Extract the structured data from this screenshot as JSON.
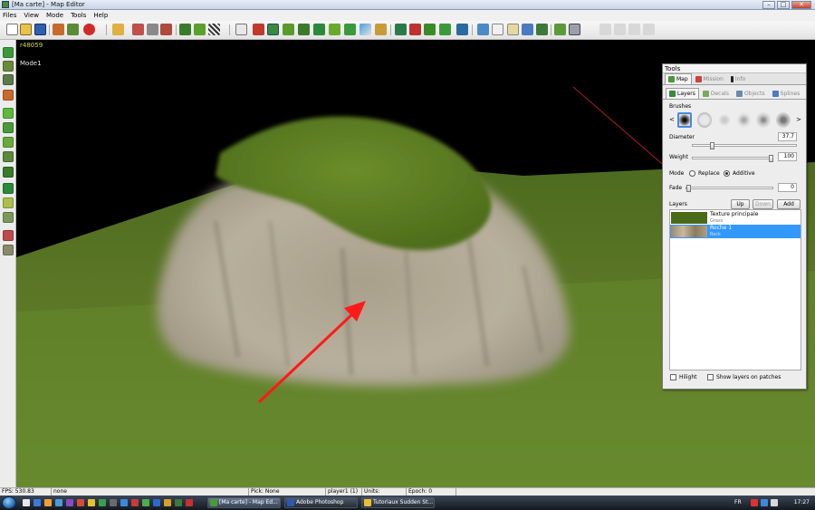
{
  "window": {
    "title": "[Ma carte] - Map Editor",
    "controls": {
      "minimize": "–",
      "maximize": "□",
      "close": "✕"
    }
  },
  "menu": [
    "Files",
    "View",
    "Mode",
    "Tools",
    "Help"
  ],
  "viewport": {
    "build_label": "r48059",
    "mode_label": "Mode1",
    "colors": {
      "sky": "#000000",
      "terrain_grass": "#5e7a28",
      "rock": "#b7ad99",
      "arrow": "#ff1a1a",
      "axis_line": "#b02020"
    }
  },
  "tools_panel": {
    "title": "Tools",
    "tabs": [
      "Map",
      "Mission",
      "Info"
    ],
    "subtabs": [
      "Layers",
      "Decals",
      "Objects",
      "Splines"
    ],
    "brushes_label": "Brushes",
    "brush_prev": "<",
    "brush_next": ">",
    "diameter": {
      "label": "Diameter",
      "value": "37.7",
      "fraction": 0.17
    },
    "weight": {
      "label": "Weight",
      "value": "100",
      "fraction": 1.0
    },
    "mode": {
      "label": "Mode",
      "options": [
        "Replace",
        "Additive"
      ],
      "selected": "Additive"
    },
    "fade": {
      "label": "Fade",
      "value": "0",
      "fraction": 0.0
    },
    "layers_label": "Layers",
    "buttons": {
      "up": "Up",
      "down": "Down",
      "add": "Add"
    },
    "layers": [
      {
        "name": "Texture principale",
        "sub": "Grass",
        "selected": false
      },
      {
        "name": "Roche 1",
        "sub": "Rock",
        "selected": true
      }
    ],
    "hilight_label": "Hilight",
    "show_layers_label": "Show layers on patches",
    "selection_color": "#3399ff"
  },
  "statusbar": {
    "fps": "FPS: 530.83",
    "selection": "none",
    "pick": "Pick: None",
    "player": "player1 (1)",
    "units": "Units:",
    "epoch": "Epoch: 0"
  },
  "taskbar": {
    "tasks": [
      {
        "label": "[Ma carte] - Map Ed...",
        "active": true
      },
      {
        "label": "Adobe Photoshop",
        "active": false
      },
      {
        "label": "Tutoriaux Sudden St...",
        "active": false
      }
    ],
    "language": "FR",
    "clock": "17:27"
  }
}
